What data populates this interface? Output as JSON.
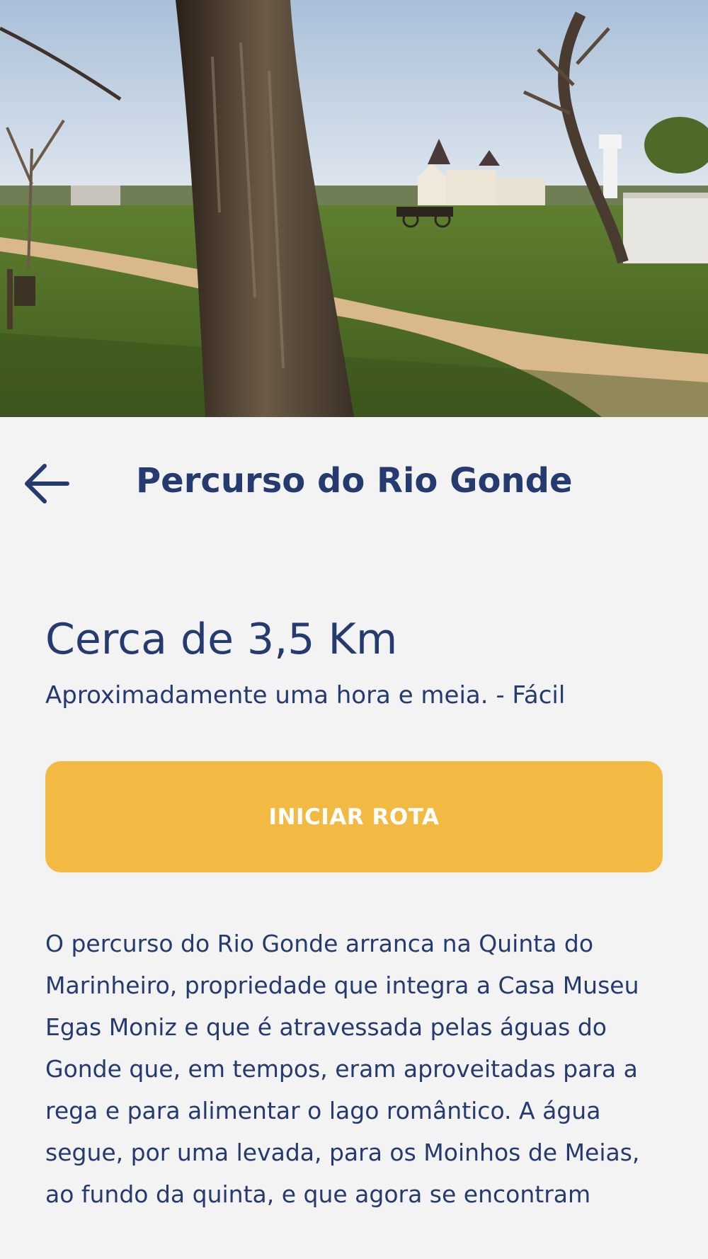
{
  "hero": {
    "image_name": "rio-gonde-park-photo"
  },
  "header": {
    "back_icon": "arrow-left-icon",
    "title": "Percurso do Rio Gonde"
  },
  "route": {
    "distance": "Cerca de 3,5 Km",
    "duration": "Aproximadamente uma hora e meia. - Fácil",
    "start_label": "INICIAR ROTA",
    "description": "O percurso do Rio Gonde arranca na Quinta do Marinheiro, propriedade que integra a Casa Museu Egas Moniz e que é atravessada pelas águas do Gonde que, em tempos, eram aproveitadas para a rega e para alimentar o lago romântico. A água segue, por uma levada, para os Moinhos de Meias, ao fundo da quinta, e que agora se encontram"
  },
  "colors": {
    "accent": "#f2ba43",
    "text": "#253a6e",
    "background": "#f3f3f3"
  }
}
